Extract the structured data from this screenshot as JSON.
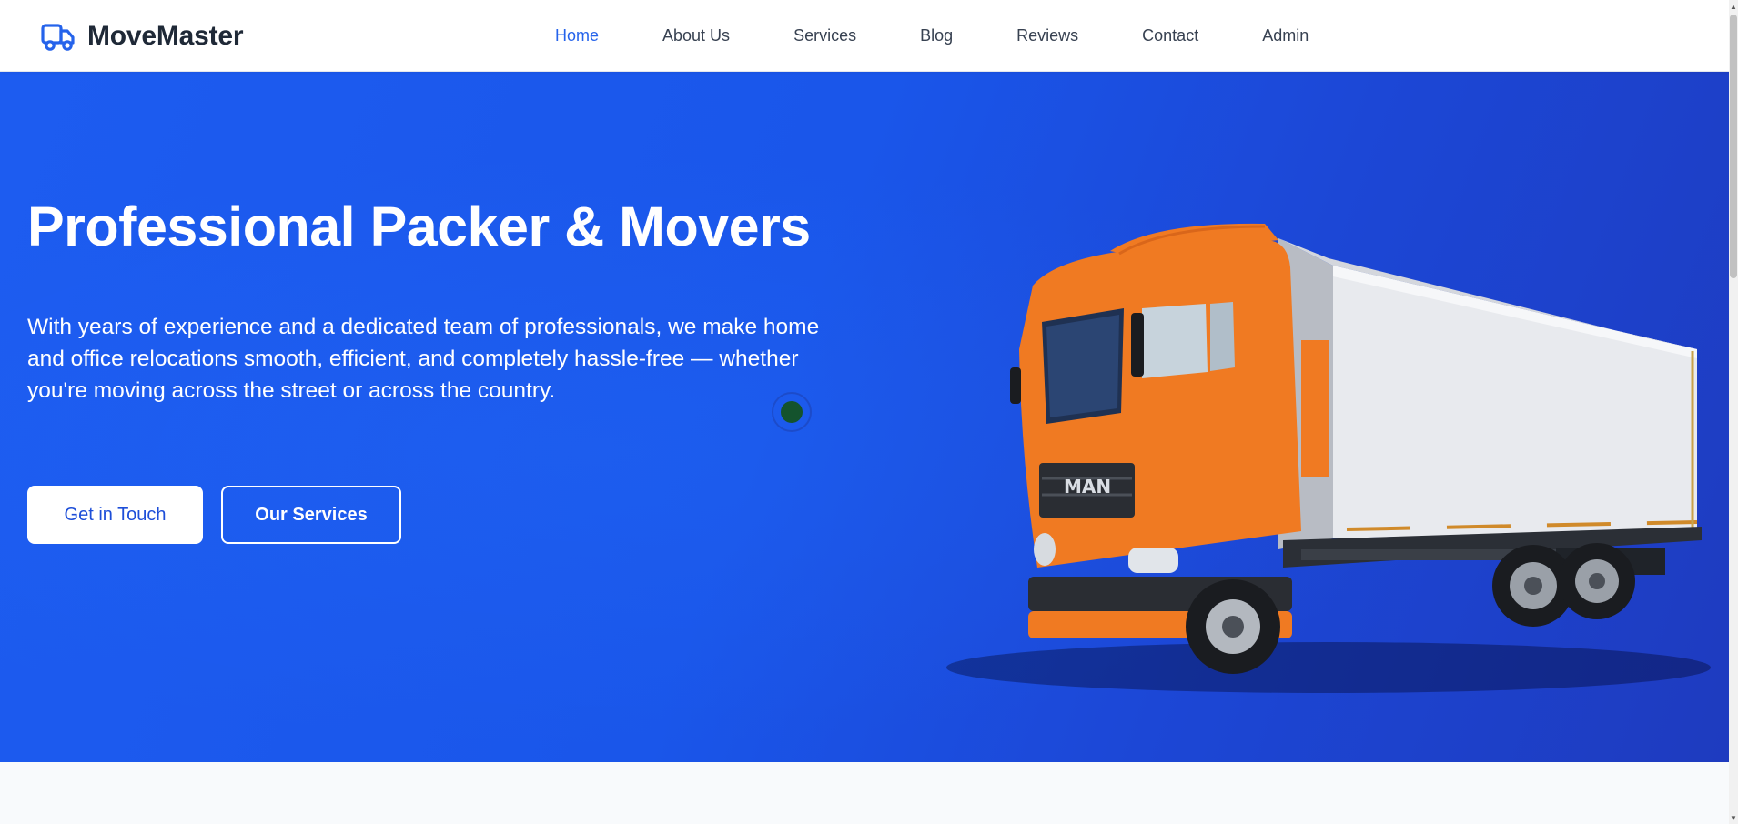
{
  "brand": {
    "name": "MoveMaster",
    "logo_icon": "truck-icon",
    "accent": "#2563eb"
  },
  "nav": {
    "items": [
      {
        "label": "Home",
        "active": true
      },
      {
        "label": "About Us",
        "active": false
      },
      {
        "label": "Services",
        "active": false
      },
      {
        "label": "Blog",
        "active": false
      },
      {
        "label": "Reviews",
        "active": false
      },
      {
        "label": "Contact",
        "active": false
      },
      {
        "label": "Admin",
        "active": false
      }
    ]
  },
  "hero": {
    "title": "Professional Packer & Movers",
    "description": "With years of experience and a dedicated team of professionals, we make home and office relocations smooth, efficient, and completely hassle-free — whether you're moving across the street or across the country.",
    "primary_button": "Get in Touch",
    "secondary_button": "Our Services",
    "background_color": "#1a56ea",
    "truck_badge": "MAN"
  }
}
